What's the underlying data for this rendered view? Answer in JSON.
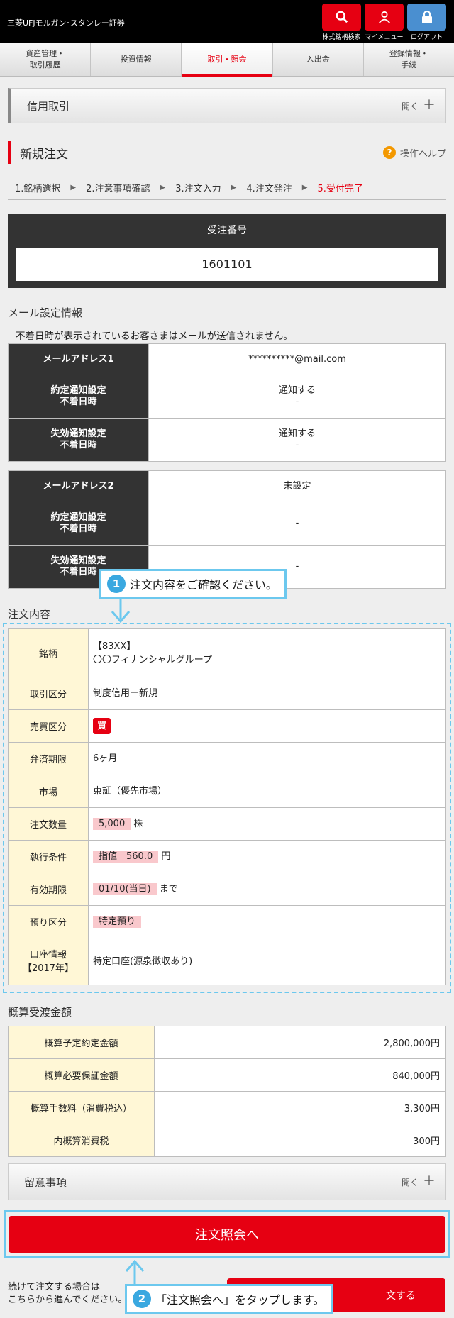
{
  "header": {
    "logo": "三菱UFJモルガン･スタンレー証券",
    "buttons": [
      {
        "label": "株式銘柄検索",
        "icon": "search-icon"
      },
      {
        "label": "マイメニュー",
        "icon": "user-icon"
      },
      {
        "label": "ログアウト",
        "icon": "lock-icon"
      }
    ]
  },
  "nav": [
    {
      "label": "資産管理・\n取引履歴"
    },
    {
      "label": "投資情報"
    },
    {
      "label": "取引・照会",
      "active": true
    },
    {
      "label": "入出金"
    },
    {
      "label": "登録情報・\n手続"
    }
  ],
  "margin_trade": {
    "title": "信用取引",
    "open_label": "開く"
  },
  "section": {
    "title": "新規注文",
    "help": "操作ヘルプ"
  },
  "steps": [
    "1.銘柄選択",
    "2.注意事項確認",
    "3.注文入力",
    "4.注文発注",
    "5.受付完了"
  ],
  "order": {
    "label": "受注番号",
    "number": "1601101"
  },
  "mail": {
    "title": "メール設定情報",
    "note": "不着日時が表示されているお客さまはメールが送信されません。",
    "table1": {
      "addr_label": "メールアドレス1",
      "addr_value": "**********@mail.com",
      "exec_label": "約定通知設定\n不着日時",
      "exec_value": "通知する\n-",
      "expire_label": "失効通知設定\n不着日時",
      "expire_value": "通知する\n-"
    },
    "table2": {
      "addr_label": "メールアドレス2",
      "addr_value": "未設定",
      "exec_label": "約定通知設定\n不着日時",
      "exec_value": "-",
      "expire_label": "失効通知設定\n不着日時",
      "expire_value": "-"
    }
  },
  "callout1": {
    "num": "1",
    "text": "注文内容をご確認ください。"
  },
  "order_detail": {
    "title": "注文内容",
    "rows": {
      "stock_label": "銘柄",
      "stock_code": "【83XX】",
      "stock_name": "〇〇フィナンシャルグループ",
      "trade_type_label": "取引区分",
      "trade_type": "制度信用ー新規",
      "side_label": "売買区分",
      "side": "買",
      "term_label": "弁済期限",
      "term": "6ヶ月",
      "market_label": "市場",
      "market": "東証（優先市場）",
      "qty_label": "注文数量",
      "qty": "5,000",
      "qty_unit": "株",
      "cond_label": "執行条件",
      "cond": "指値　560.0",
      "cond_unit": "円",
      "expiry_label": "有効期限",
      "expiry": "01/10(当日)",
      "expiry_suffix": "まで",
      "custody_label": "預り区分",
      "custody": "特定預り",
      "account_label": "口座情報\n【2017年】",
      "account": "特定口座(源泉徴収あり)"
    }
  },
  "amount": {
    "title": "概算受渡金額",
    "rows": [
      {
        "label": "概算予定約定金額",
        "value": "2,800,000円"
      },
      {
        "label": "概算必要保証金額",
        "value": "840,000円"
      },
      {
        "label": "概算手数料（消費税込）",
        "value": "3,300円"
      },
      {
        "label": "内概算消費税",
        "value": "300円"
      }
    ]
  },
  "notes_bar": {
    "title": "留意事項",
    "open_label": "開く"
  },
  "main_button": "注文照会へ",
  "bottom_note": "続けて注文する場合は\nこちらから進んでください。",
  "sub_button": "文する",
  "callout2": {
    "num": "2",
    "text": "「注文照会へ」をタップします。"
  }
}
